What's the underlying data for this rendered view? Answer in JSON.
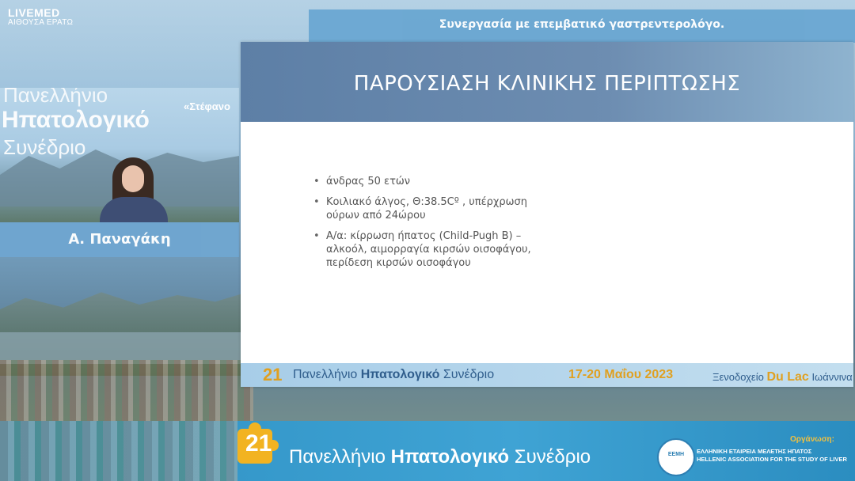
{
  "logo": {
    "brand": "LIVEMED",
    "room": "ΑΙΘΟΥΣΑ ΕΡΑΤΩ"
  },
  "top_banner": "Συνεργασία με επεμβατικό γαστρεντερολόγο.",
  "speaker": {
    "name": "Α. Παναγάκη",
    "backdrop_line1": "Πανελλήνιο",
    "backdrop_line2": "Ηπατολογικό",
    "backdrop_line3": "Συνέδριο",
    "backdrop_quote": "«Στέφανο"
  },
  "slide": {
    "title": "ΠΑΡΟΥΣΙΑΣΗ ΚΛΙΝΙΚΗΣ ΠΕΡΙΠΤΩΣΗΣ",
    "bullets": [
      "άνδρας 50 ετών",
      "Κοιλιακό άλγος, Θ:38.5Cº , υπέρχρωση ούρων από 24ώρου",
      "Α/α: κίρρωση ήπατος (Child-Pugh B) – αλκοόλ, αιμορραγία κιρσών οισοφάγου, περίδεση κιρσών οισοφάγου"
    ],
    "footer": {
      "number": "21",
      "text_a": "Πανελλήνιο",
      "text_b": "Ηπατολογικό",
      "text_c": "Συνέδριο",
      "dates": "17-20 Μαΐου 2023",
      "venue_a": "Ξενοδοχείο",
      "venue_b": "Du Lac",
      "venue_c": "Ιωάννινα"
    }
  },
  "bottom_bar": {
    "number": "21",
    "title_a": "Πανελλήνιο",
    "title_b": "Ηπατολογικό",
    "title_c": "Συνέδριο",
    "organizer_label": "Οργάνωση:",
    "seal_text": "ΕΕΜΗ",
    "association_gr": "ΕΛΛΗΝΙΚΗ ΕΤΑΙΡΕΙΑ ΜΕΛΕΤΗΣ ΗΠΑΤΟΣ",
    "association_en": "HELLENIC ASSOCIATION FOR THE STUDY OF LIVER"
  },
  "colors": {
    "accent_blue": "#6fa6d0",
    "gold": "#e0a020",
    "slide_header": "#6d8db1"
  }
}
